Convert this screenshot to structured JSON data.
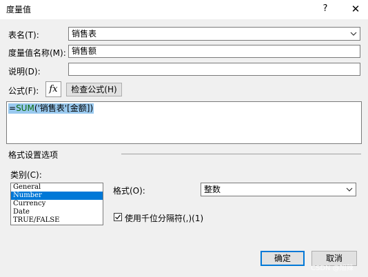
{
  "dialog": {
    "title": "度量值",
    "help_glyph": "?",
    "close_glyph": "✕"
  },
  "form": {
    "table_label": "表名(T):",
    "table_value": "销售表",
    "measure_name_label": "度量值名称(M):",
    "measure_name_value": "销售额",
    "description_label": "说明(D):",
    "description_value": "",
    "formula_label": "公式(F):",
    "fx_label": "fx",
    "check_formula_label": "检查公式(H)",
    "formula_operator": "=",
    "formula_function": "SUM",
    "formula_args": "('销售表'[金额])"
  },
  "format_section": {
    "title": "格式设置选项",
    "category_label": "类别(C):",
    "categories": [
      "General",
      "Number",
      "Currency",
      "Date",
      "TRUE/FALSE"
    ],
    "selected_category": "Number",
    "format_label": "格式(O):",
    "format_value": "整数",
    "thousands_separator_label": "使用千位分隔符(,)(1)",
    "thousands_separator_checked": true
  },
  "buttons": {
    "ok": "确定",
    "cancel": "取消"
  },
  "watermark": "CSDN @旭辣",
  "colors": {
    "selection": "#0078d7",
    "formula_highlight": "#99c9ef",
    "function_name": "#0b6a0b"
  }
}
